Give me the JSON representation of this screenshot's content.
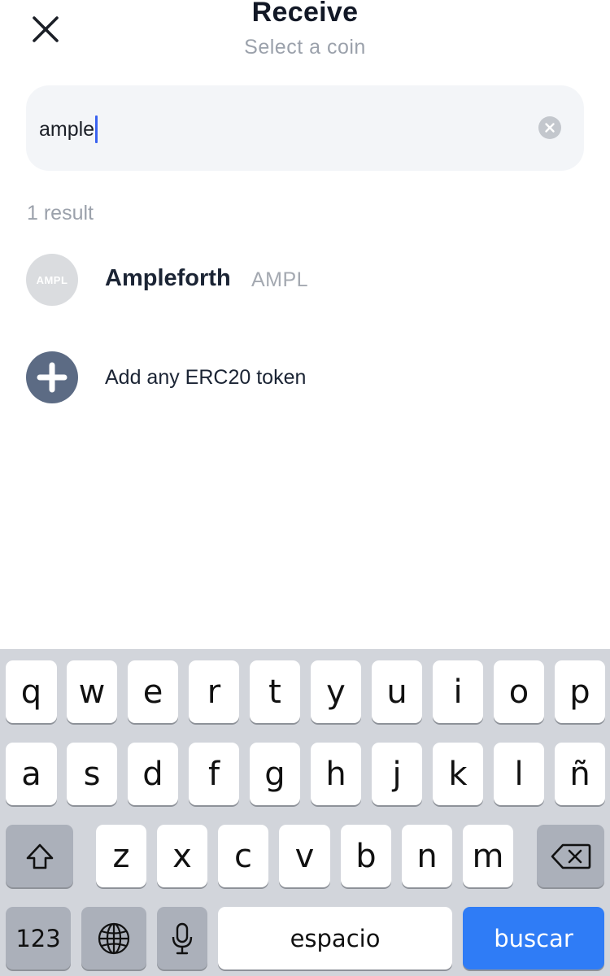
{
  "header": {
    "title": "Receive",
    "subtitle": "Select a coin"
  },
  "search": {
    "value": "ample"
  },
  "results": {
    "count_label": "1 result",
    "items": [
      {
        "icon_text": "AMPL",
        "name": "Ampleforth",
        "symbol": "AMPL"
      }
    ]
  },
  "add_token": {
    "label": "Add any ERC20 token"
  },
  "keyboard": {
    "row1": [
      "q",
      "w",
      "e",
      "r",
      "t",
      "y",
      "u",
      "i",
      "o",
      "p"
    ],
    "row2": [
      "a",
      "s",
      "d",
      "f",
      "g",
      "h",
      "j",
      "k",
      "l",
      "ñ"
    ],
    "row3": [
      "z",
      "x",
      "c",
      "v",
      "b",
      "n",
      "m"
    ],
    "numbers_label": "123",
    "space_label": "espacio",
    "action_label": "buscar"
  },
  "colors": {
    "accent": "#2f7cf6",
    "caret": "#3a62f0",
    "add_icon_bg": "#5c6b84"
  },
  "icons": {
    "close": "close-icon",
    "clear": "clear-search-icon",
    "add": "plus-icon",
    "shift": "shift-icon",
    "delete": "delete-icon",
    "globe": "globe-icon",
    "mic": "microphone-icon"
  }
}
